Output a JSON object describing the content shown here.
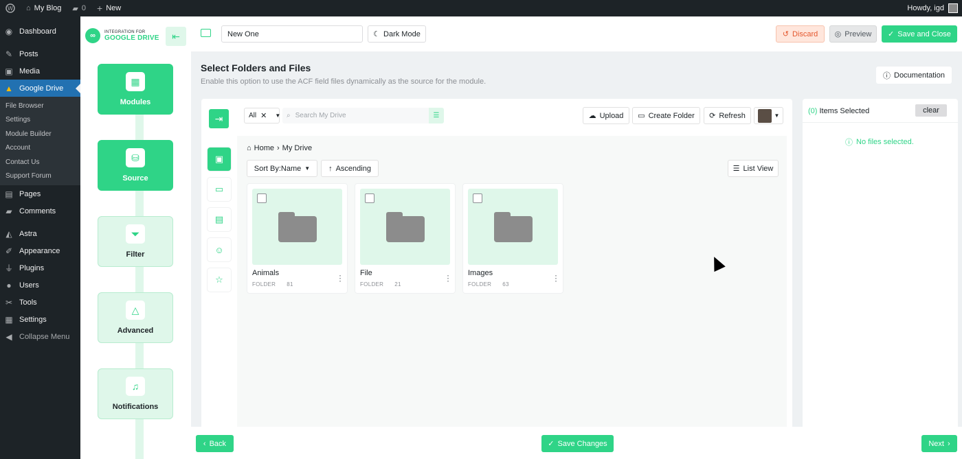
{
  "adminbar": {
    "site_name": "My Blog",
    "comments_count": "0",
    "new_label": "New",
    "greeting": "Howdy, igd"
  },
  "wpmenu": {
    "dashboard": "Dashboard",
    "posts": "Posts",
    "media": "Media",
    "google_drive": "Google Drive",
    "submenu": [
      "File Browser",
      "Settings",
      "Module Builder",
      "Account",
      "Contact Us",
      "Support Forum"
    ],
    "pages": "Pages",
    "comments": "Comments",
    "astra": "Astra",
    "appearance": "Appearance",
    "plugins": "Plugins",
    "users": "Users",
    "tools": "Tools",
    "settings": "Settings",
    "collapse": "Collapse Menu"
  },
  "header": {
    "logo_small": "INTEGRATION FOR",
    "logo_big": "GOOGLE DRIVE",
    "module_title": "New One",
    "dark_mode": "Dark Mode",
    "discard": "Discard",
    "preview": "Preview",
    "save_close": "Save and Close"
  },
  "steps": [
    "Modules",
    "Source",
    "Filter",
    "Advanced",
    "Notifications"
  ],
  "main": {
    "title": "Select Folders and Files",
    "description": "Enable this option to use the ACF field files dynamically as the source for the module.",
    "documentation": "Documentation"
  },
  "toolbar": {
    "filter_value": "All",
    "search_placeholder": "Search My Drive",
    "upload": "Upload",
    "create_folder": "Create Folder",
    "refresh": "Refresh"
  },
  "browser": {
    "breadcrumb_home": "Home",
    "breadcrumb_current": "My Drive",
    "sort_label": "Sort By:Name",
    "order_label": "Ascending",
    "view_label": "List View",
    "items": [
      {
        "name": "Animals",
        "type": "FOLDER",
        "count": "81"
      },
      {
        "name": "File",
        "type": "FOLDER",
        "count": "21"
      },
      {
        "name": "Images",
        "type": "FOLDER",
        "count": "63"
      }
    ]
  },
  "selection": {
    "count": "(0)",
    "label": "Items Selected",
    "clear": "clear",
    "empty": "No files selected."
  },
  "footer": {
    "back": "Back",
    "save": "Save Changes",
    "next": "Next"
  },
  "colors": {
    "accent": "#2fd487",
    "accent_light": "#dff7ea",
    "wp_dark": "#1d2327",
    "wp_blue": "#2271b1",
    "discard": "#e4572e"
  }
}
